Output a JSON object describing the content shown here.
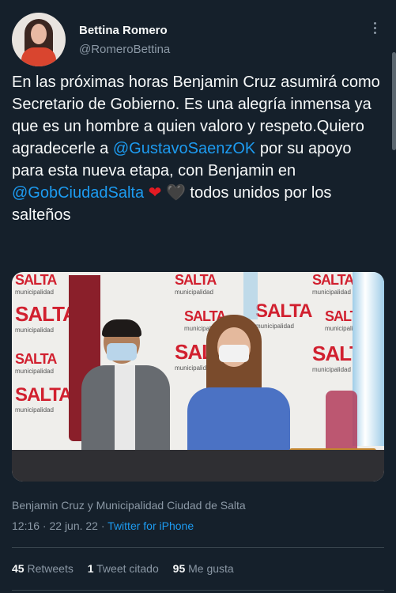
{
  "author": {
    "name": "Bettina Romero",
    "handle": "@RomeroBettina"
  },
  "tweet": {
    "text1": "En las próximas horas Benjamin Cruz asumirá como Secretario de Gobierno. Es una alegría inmensa ya que es un hombre a quien valoro y respeto.Quiero agradecerle a ",
    "mention1": "@GustavoSaenzOK",
    "text2": " por su apoyo para esta nueva etapa, con Benjamin en ",
    "mention2": "@GobCiudadSalta",
    "heart1": "❤",
    "heart2": "🖤",
    "text3": " todos unidos por los salteños"
  },
  "media": {
    "logo_text": "SALTA",
    "logo_sub": "municipalidad"
  },
  "caption": "Benjamin Cruz y Municipalidad Ciudad de Salta",
  "meta": {
    "time": "12:16 · 22 jun. 22 · ",
    "source": "Twitter for iPhone"
  },
  "stats": {
    "retweets_count": "45",
    "retweets_label": "Retweets",
    "quotes_count": "1",
    "quotes_label": "Tweet citado",
    "likes_count": "95",
    "likes_label": "Me gusta"
  }
}
